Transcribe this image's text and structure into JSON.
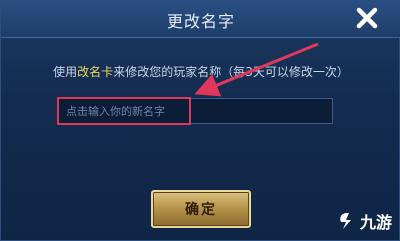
{
  "dialog": {
    "title": "更改名字",
    "description_prefix": "使用",
    "description_highlight": "改名卡",
    "description_suffix": "来修改您的玩家名称（每3天可以修改一次）",
    "input_placeholder": "点击输入你的新名字",
    "confirm_label": "确定"
  },
  "watermark": {
    "text": "九游"
  },
  "colors": {
    "highlight_text": "#e8d85a",
    "annotation": "#e0385c",
    "button_gold": "#b8954c"
  },
  "icons": {
    "close": "close-icon",
    "annotation_arrow": "arrow-icon"
  }
}
